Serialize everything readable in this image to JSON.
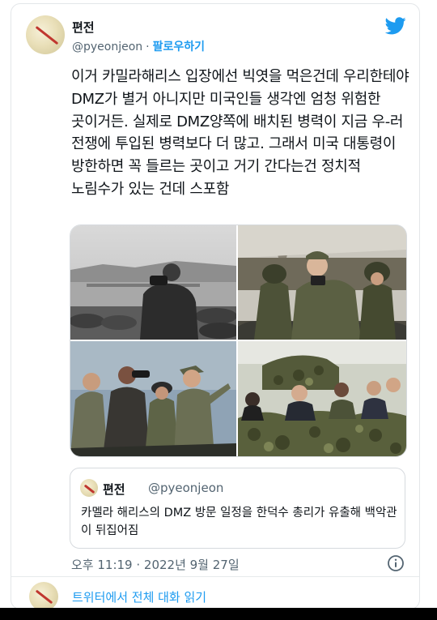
{
  "tweet": {
    "author_name": "편전",
    "handle": "@pyeonjeon",
    "separator": "·",
    "follow_label": "팔로우하기",
    "platform_icon": "twitter-bird-icon",
    "text": "이거 카밀라해리스 입장에선 빅엿을 먹은건데 우리한테야 DMZ가 별거 아니지만 미국인들 생각엔 엄청 위험한 곳이거든. 실제로 DMZ양쪽에 배치된 병력이 지금 우-러 전쟁에 투입된 병력보다 더 많고. 그래서 미국 대통령이 방한하면 꼭 들르는 곳이고 거기 간다는건 정치적 노림수가 있는 건데 스포함",
    "timestamp": "오후 11:19 · 2022년 9월 27일"
  },
  "quoted_tweet": {
    "author_name": "편전",
    "handle": "@pyeonjeon",
    "text": "카멜라 해리스의 DMZ 방문 일정을 한덕수 총리가 유출해 백악관이 뒤집어짐"
  },
  "footer": {
    "read_more_label": "트위터에서 전체 대화 읽기"
  },
  "colors": {
    "accent": "#1d9bf0",
    "text": "#0f1419",
    "secondary": "#536471",
    "border": "#d6dade"
  }
}
